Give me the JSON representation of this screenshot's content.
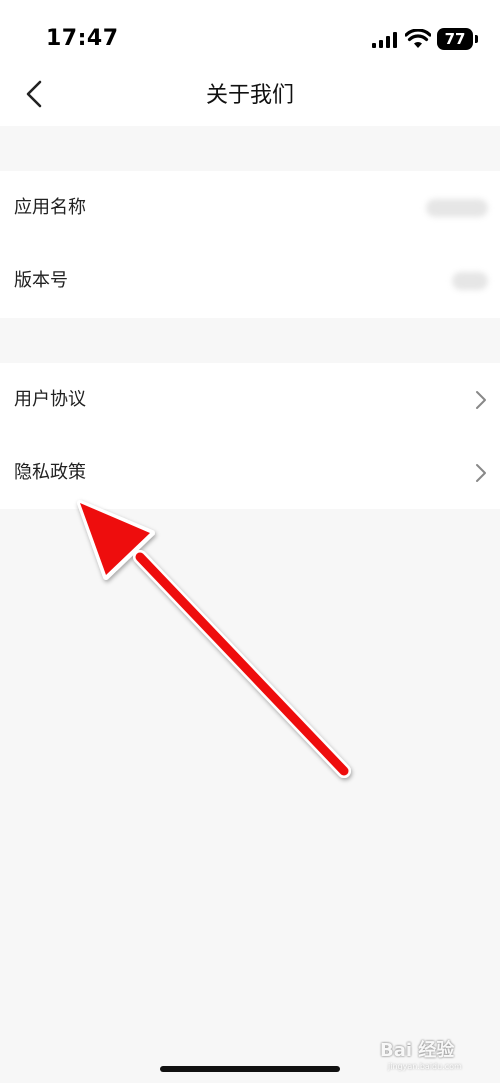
{
  "status_bar": {
    "time": "17:47",
    "battery_level": "77",
    "icons": [
      "signal-icon",
      "wifi-icon",
      "battery-icon"
    ]
  },
  "nav": {
    "title": "关于我们",
    "back_icon": "chevron-left-icon"
  },
  "info_group": {
    "items": [
      {
        "label": "应用名称"
      },
      {
        "label": "版本号"
      }
    ]
  },
  "link_group": {
    "items": [
      {
        "label": "用户协议",
        "icon": "chevron-right-icon"
      },
      {
        "label": "隐私政策",
        "icon": "chevron-right-icon"
      }
    ]
  },
  "annotation": {
    "icon": "red-arrow-icon",
    "color": "#ee1111"
  },
  "watermark": {
    "text": "Bai 经验",
    "sub": "jingyan.baidu.com"
  },
  "colors": {
    "background": "#f7f7f7",
    "surface": "#ffffff",
    "text": "#222222",
    "chevron": "#888888"
  }
}
